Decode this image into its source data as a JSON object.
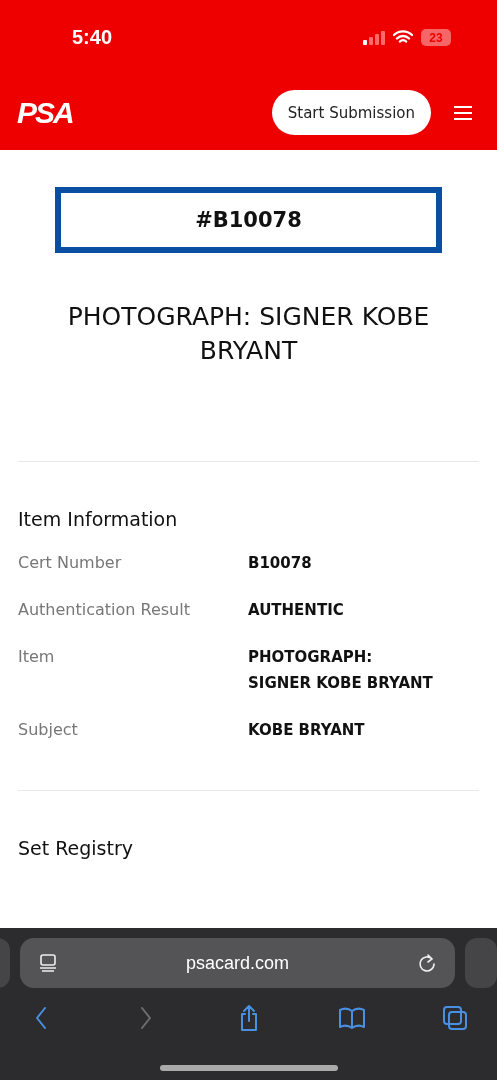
{
  "status_bar": {
    "time": "5:40",
    "battery": "23"
  },
  "header": {
    "logo": "PSA",
    "button": "Start Submission"
  },
  "cert_number": "#B10078",
  "title": "PHOTOGRAPH: SIGNER KOBE BRYANT",
  "item_information": {
    "heading": "Item Information",
    "rows": [
      {
        "label": "Cert Number",
        "value": "B10078"
      },
      {
        "label": "Authentication Result",
        "value": "AUTHENTIC"
      },
      {
        "label": "Item",
        "value": "PHOTOGRAPH:\nSIGNER KOBE BRYANT"
      },
      {
        "label": "Subject",
        "value": "KOBE BRYANT"
      }
    ]
  },
  "set_registry": {
    "heading": "Set Registry"
  },
  "browser": {
    "url": "psacard.com",
    "toolbar": [
      {
        "kind": "back",
        "disabled": false
      },
      {
        "kind": "forward",
        "disabled": true
      },
      {
        "kind": "share",
        "disabled": false
      },
      {
        "kind": "bookmarks",
        "disabled": false
      },
      {
        "kind": "tabs",
        "disabled": false
      }
    ]
  }
}
